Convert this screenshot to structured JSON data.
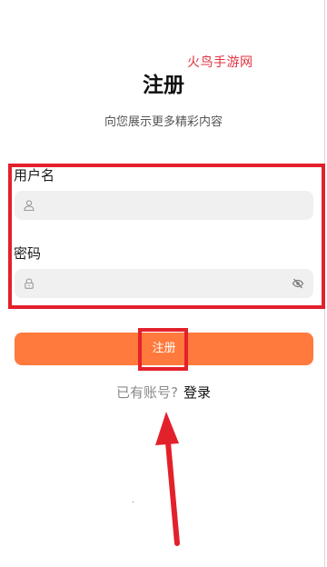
{
  "watermark": {
    "text": "火鸟手游网"
  },
  "header": {
    "title": "注册",
    "subtitle": "向您展示更多精彩内容"
  },
  "form": {
    "username": {
      "label": "用户名",
      "value": "",
      "placeholder": "",
      "icon": "user-icon"
    },
    "password": {
      "label": "密码",
      "value": "",
      "placeholder": "",
      "icon": "lock-icon",
      "toggle_icon": "eye-off-icon"
    },
    "submit_label": "注册"
  },
  "footer": {
    "prompt": "已有账号?",
    "login_link": "登录"
  },
  "colors": {
    "accent": "#ff7a3c",
    "annotation": "#e3212b",
    "field_bg": "#f0f0f0"
  }
}
